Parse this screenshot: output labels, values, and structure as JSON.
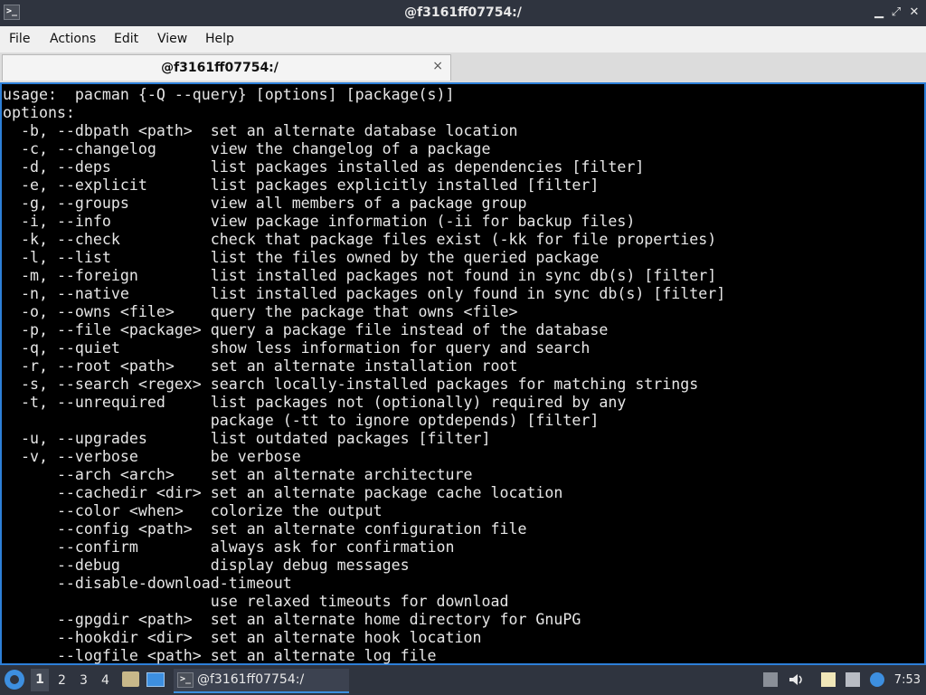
{
  "window": {
    "title": "@f3161ff07754:/",
    "app_icon": "terminal-icon",
    "controls": [
      "minimize",
      "maximize",
      "close"
    ]
  },
  "menubar": {
    "items": [
      "File",
      "Actions",
      "Edit",
      "View",
      "Help"
    ]
  },
  "tab": {
    "label": "@f3161ff07754:/",
    "close": "×"
  },
  "terminal": {
    "lines": [
      "usage:  pacman {-Q --query} [options] [package(s)]",
      "options:",
      "  -b, --dbpath <path>  set an alternate database location",
      "  -c, --changelog      view the changelog of a package",
      "  -d, --deps           list packages installed as dependencies [filter]",
      "  -e, --explicit       list packages explicitly installed [filter]",
      "  -g, --groups         view all members of a package group",
      "  -i, --info           view package information (-ii for backup files)",
      "  -k, --check          check that package files exist (-kk for file properties)",
      "  -l, --list           list the files owned by the queried package",
      "  -m, --foreign        list installed packages not found in sync db(s) [filter]",
      "  -n, --native         list installed packages only found in sync db(s) [filter]",
      "  -o, --owns <file>    query the package that owns <file>",
      "  -p, --file <package> query a package file instead of the database",
      "  -q, --quiet          show less information for query and search",
      "  -r, --root <path>    set an alternate installation root",
      "  -s, --search <regex> search locally-installed packages for matching strings",
      "  -t, --unrequired     list packages not (optionally) required by any",
      "                       package (-tt to ignore optdepends) [filter]",
      "  -u, --upgrades       list outdated packages [filter]",
      "  -v, --verbose        be verbose",
      "      --arch <arch>    set an alternate architecture",
      "      --cachedir <dir> set an alternate package cache location",
      "      --color <when>   colorize the output",
      "      --config <path>  set an alternate configuration file",
      "      --confirm        always ask for confirmation",
      "      --debug          display debug messages",
      "      --disable-download-timeout",
      "                       use relaxed timeouts for download",
      "      --gpgdir <path>  set an alternate home directory for GnuPG",
      "      --hookdir <dir>  set an alternate hook location",
      "      --logfile <path> set an alternate log file"
    ]
  },
  "taskbar": {
    "workspaces": [
      "1",
      "2",
      "3",
      "4"
    ],
    "active_workspace": "1",
    "task_label": "@f3161ff07754:/",
    "tray_icons": [
      "removable-media-icon",
      "volume-icon",
      "clipboard-icon",
      "network-icon",
      "notification-icon"
    ],
    "clock": "7:53"
  }
}
